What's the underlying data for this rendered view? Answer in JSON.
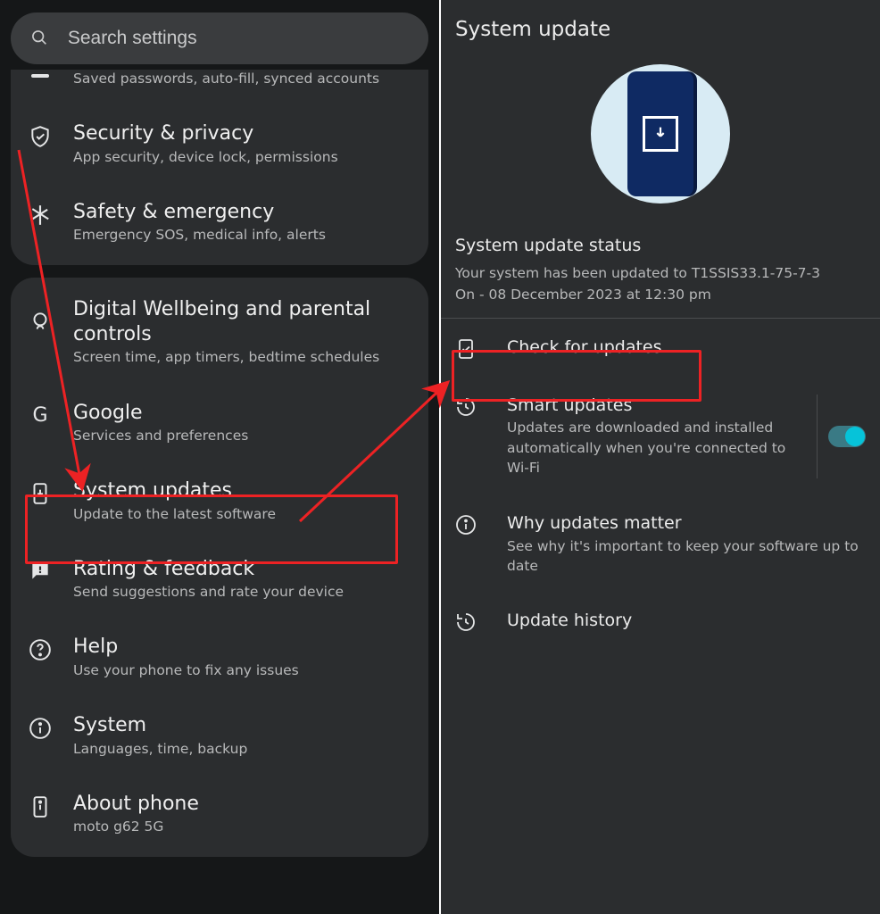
{
  "left": {
    "search_placeholder": "Search settings",
    "truncated_subtitle": "Saved passwords, auto-fill, synced accounts",
    "groupA": [
      {
        "title": "Security & privacy",
        "sub": "App security, device lock, permissions"
      },
      {
        "title": "Safety & emergency",
        "sub": "Emergency SOS, medical info, alerts"
      }
    ],
    "groupB": [
      {
        "title": "Digital Wellbeing and parental controls",
        "sub": "Screen time, app timers, bedtime schedules"
      },
      {
        "title": "Google",
        "sub": "Services and preferences"
      },
      {
        "title": "System updates",
        "sub": "Update to the latest software"
      },
      {
        "title": "Rating & feedback",
        "sub": "Send suggestions and rate your device"
      },
      {
        "title": "Help",
        "sub": "Use your phone to fix any issues"
      },
      {
        "title": "System",
        "sub": "Languages, time, backup"
      },
      {
        "title": "About phone",
        "sub": "moto g62 5G"
      }
    ]
  },
  "right": {
    "header": "System update",
    "status_title": "System update status",
    "status_line1": "Your system has been updated to T1SSIS33.1-75-7-3",
    "status_line2": "On - 08 December 2023 at 12:30 pm",
    "items": {
      "check": "Check for updates",
      "smart_title": "Smart updates",
      "smart_sub": "Updates are downloaded and installed automatically when you're connected to Wi-Fi",
      "why_title": "Why updates matter",
      "why_sub": "See why it's important to keep your software up to date",
      "history": "Update history"
    },
    "smart_toggle_on": true
  }
}
